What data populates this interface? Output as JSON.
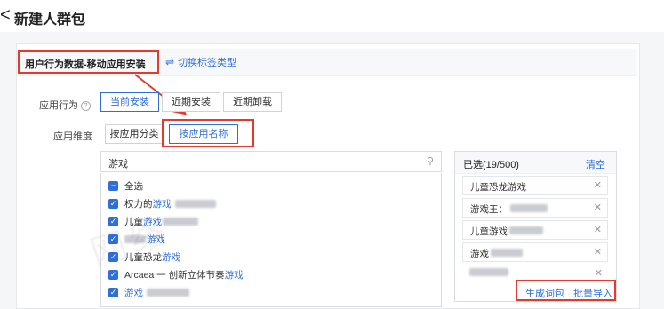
{
  "header": {
    "back": "<",
    "title": "新建人群包"
  },
  "source_tab": {
    "label": "用户行为数据-移动应用安装"
  },
  "switch_tag": {
    "icon": "⇌",
    "label": "切换标签类型"
  },
  "app_behavior": {
    "label": "应用行为",
    "options": [
      "当前安装",
      "近期安装",
      "近期卸载"
    ],
    "selected": "当前安装"
  },
  "app_dimension": {
    "label": "应用维度",
    "options": [
      "按应用分类",
      "按应用名称"
    ],
    "selected": "按应用名称"
  },
  "search": {
    "value": "游戏"
  },
  "results": {
    "select_all": "全选",
    "items": [
      {
        "prefix": "权力的",
        "keyword": "游戏",
        "suffix": ""
      },
      {
        "prefix": "儿童",
        "keyword": "游戏",
        "suffix": ""
      },
      {
        "prefix": "",
        "keyword": "游戏",
        "suffix": ""
      },
      {
        "prefix": "儿童恐龙",
        "keyword": "游戏",
        "suffix": ""
      },
      {
        "prefix": "Arcaea 一 创新立体节奏",
        "keyword": "游戏",
        "suffix": ""
      },
      {
        "prefix": "",
        "keyword": "游戏",
        "suffix": ""
      }
    ]
  },
  "selected_panel": {
    "count_label": "已选(19/500)",
    "clear": "清空",
    "items": [
      "儿童恐龙游戏",
      "游戏王：",
      "儿童游戏",
      "游戏",
      ""
    ]
  },
  "actions": {
    "generate": "生成词包",
    "import": "批量导入"
  },
  "watermark": "网络",
  "colors": {
    "accent": "#2f6fd6",
    "highlight": "#e23a2d"
  }
}
